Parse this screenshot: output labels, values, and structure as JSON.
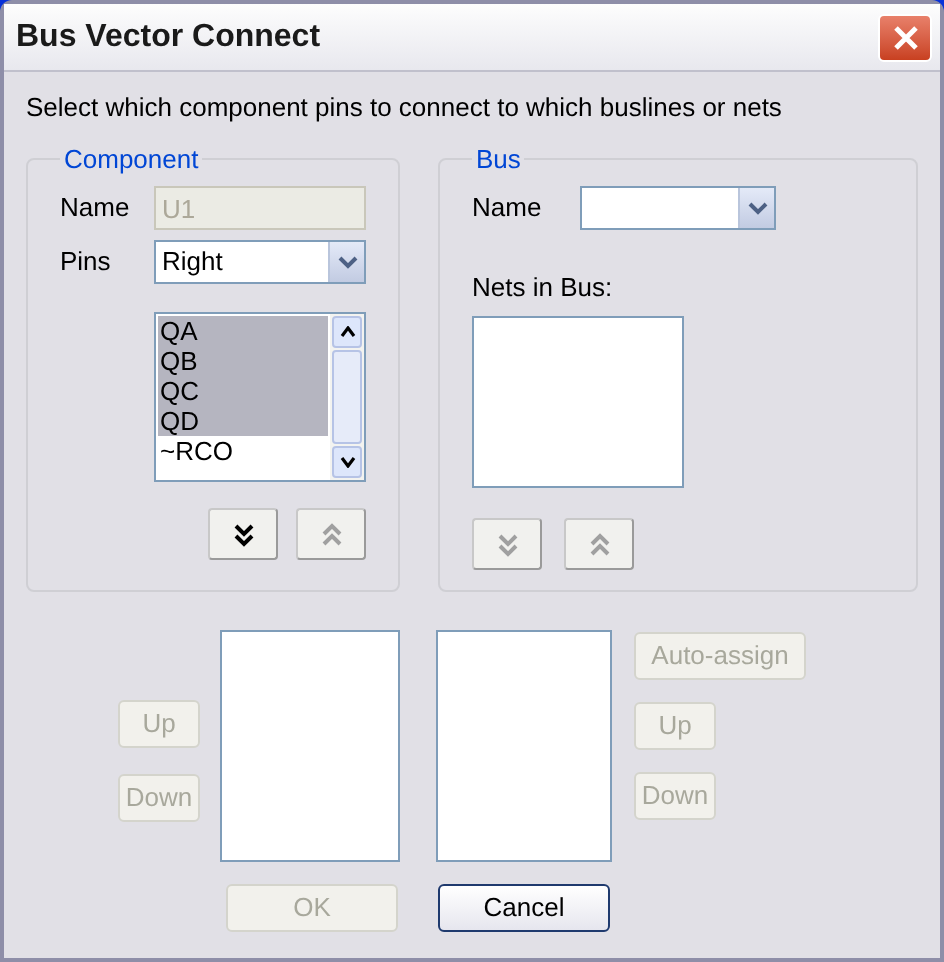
{
  "window": {
    "title": "Bus Vector Connect"
  },
  "instruction": "Select which component pins to connect to which buslines or nets",
  "component": {
    "legend": "Component",
    "name_label": "Name",
    "name_value": "U1",
    "name_disabled": true,
    "pins_label": "Pins",
    "pins_value": "Right",
    "pins": [
      {
        "label": "QA",
        "selected": true
      },
      {
        "label": "QB",
        "selected": true
      },
      {
        "label": "QC",
        "selected": true
      },
      {
        "label": "QD",
        "selected": true
      },
      {
        "label": "~RCO",
        "selected": false
      }
    ],
    "move_buttons": [
      {
        "kind": "down",
        "disabled": false
      },
      {
        "kind": "up",
        "disabled": true
      }
    ]
  },
  "bus": {
    "legend": "Bus",
    "name_label": "Name",
    "nets_label": "Nets in Bus:",
    "move_buttons": [
      {
        "kind": "down",
        "disabled": true
      },
      {
        "kind": "up",
        "disabled": true
      }
    ]
  },
  "left_buttons": [
    {
      "label": "Up",
      "disabled": true
    },
    {
      "label": "Down",
      "disabled": true
    }
  ],
  "right_buttons": [
    {
      "label": "Auto-assign",
      "disabled": true
    },
    {
      "label": "Up",
      "disabled": true
    },
    {
      "label": "Down",
      "disabled": true
    }
  ],
  "dialog_buttons": [
    {
      "label": "OK",
      "disabled": true
    },
    {
      "label": "Cancel",
      "disabled": false
    }
  ]
}
